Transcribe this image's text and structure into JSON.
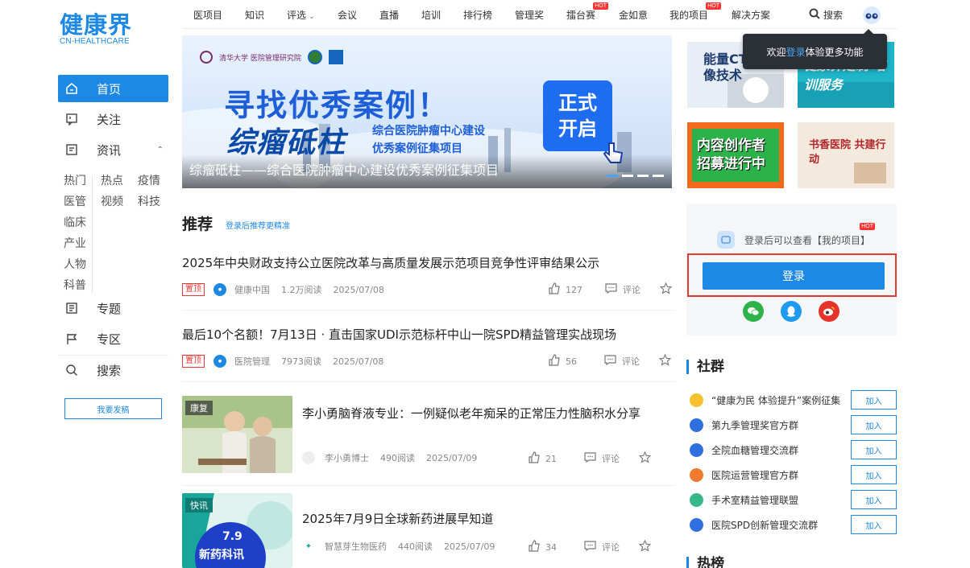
{
  "logo": {
    "main": "健康界",
    "sub": "CN-HEALTHCARE"
  },
  "topnav": {
    "items": [
      "医项目",
      "知识",
      "评选",
      "会议",
      "直播",
      "培训",
      "排行榜",
      "管理奖",
      "擂台赛",
      "金如意",
      "我的项目",
      "解决方案"
    ],
    "hot_badge": "HOT",
    "search_label": "搜索"
  },
  "sidebar": {
    "home": "首页",
    "follow": "关注",
    "news": "资讯",
    "news_sub": [
      "热门",
      "热点",
      "疫情",
      "医管",
      "视频",
      "科技",
      "临床",
      "产业",
      "人物",
      "科普"
    ],
    "topic": "专题",
    "zone": "专区",
    "search": "搜索",
    "submit": "我要发稿"
  },
  "banner": {
    "org_text": "清华大学 医院管理研究院",
    "headline": "寻找优秀案例！",
    "brush": "综瘤砥柱",
    "sub1": "综合医院肿瘤中心建设",
    "sub2": "优秀案例征集项目",
    "box1": "正式",
    "box2": "开启",
    "caption": "综瘤砥柱——综合医院肿瘤中心建设优秀案例征集项目"
  },
  "recommend": {
    "title": "推荐",
    "hint": "登录后推荐更精准",
    "comment_label": "评论",
    "articles": [
      {
        "title": "2025年中央财政支持公立医院改革与高质量发展示范项目竞争性评审结果公示",
        "pin": "置顶",
        "source": "健康中国",
        "reads": "1.2万阅读",
        "date": "2025/07/08",
        "likes": "127"
      },
      {
        "title": "最后10个名额！7月13日 · 直击国家UDI示范标杆中山一院SPD精益管理实战现场",
        "pin": "置顶",
        "source": "医院管理",
        "reads": "7973阅读",
        "date": "2025/07/08",
        "likes": "56"
      },
      {
        "title": "李小勇脑脊液专业：一例疑似老年痴呆的正常压力性脑积水分享",
        "tag": "康复",
        "source": "李小勇博士",
        "reads": "490阅读",
        "date": "2025/07/09",
        "likes": "21"
      },
      {
        "title": "2025年7月9日全球新药进展早知道",
        "tag": "快讯",
        "thumb_num": "7.9",
        "thumb_text": "新药科讯",
        "source": "智慧芽生物医药",
        "reads": "440阅读",
        "date": "2025/07/09",
        "likes": "34"
      }
    ]
  },
  "right": {
    "tooltip_pre": "欢迎",
    "tooltip_link": "登录",
    "tooltip_post": "体验更多功能",
    "promos": [
      "能量CT 成像技术",
      "健康界定制 培训服务",
      "内容创作者 招募进行中",
      "书香医院 共建行动"
    ],
    "login_hint": "登录后可以查看【我的项目】",
    "login_btn": "登录",
    "community_title": "社群",
    "join_label": "加入",
    "groups": [
      "“健康为民 体验提升”案例征集",
      "第九季管理奖官方群",
      "全院血糖管理交流群",
      "医院运营管理官方群",
      "手术室精益管理联盟",
      "医院SPD创新管理交流群"
    ],
    "hot_title": "热榜"
  },
  "colors": {
    "brand": "#1e88e5",
    "pin": "#e53935"
  }
}
